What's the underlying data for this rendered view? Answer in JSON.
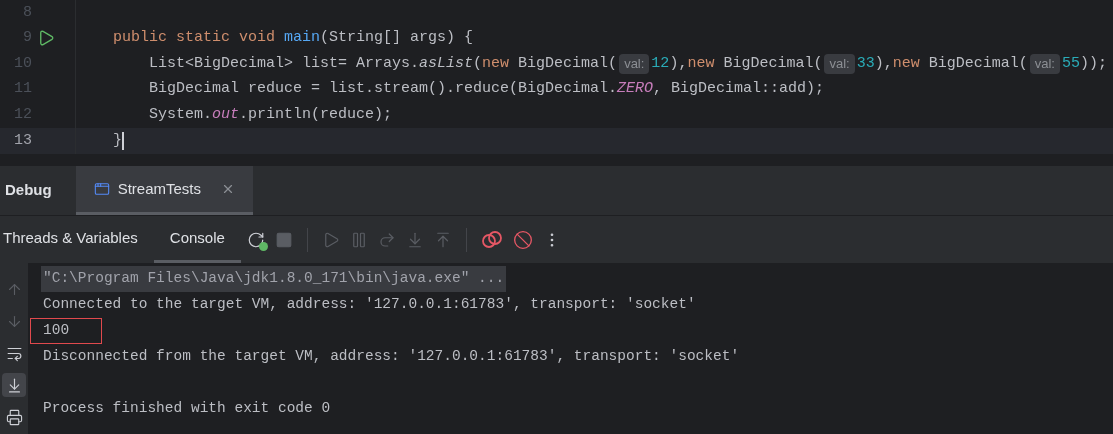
{
  "editor": {
    "lines": [
      {
        "number": "8",
        "current": false,
        "runnable": false,
        "kind": "blank"
      },
      {
        "number": "9",
        "current": false,
        "runnable": true,
        "kind": "signature",
        "tokens": [
          {
            "kind": "keyword",
            "text": "public static void "
          },
          {
            "kind": "method",
            "text": "main"
          },
          {
            "kind": "plain",
            "text": "(String[] args) {"
          }
        ]
      },
      {
        "number": "10",
        "current": false,
        "runnable": false,
        "kind": "statement",
        "tokens": [
          {
            "kind": "plain",
            "text": "List<BigDecimal> list= Arrays."
          },
          {
            "kind": "italic",
            "text": "asList"
          },
          {
            "kind": "plain",
            "text": "("
          },
          {
            "kind": "keyword",
            "text": "new "
          },
          {
            "kind": "plain",
            "text": "BigDecimal("
          },
          {
            "kind": "hint",
            "text": "val:"
          },
          {
            "kind": "number",
            "text": "12"
          },
          {
            "kind": "plain",
            "text": "),"
          },
          {
            "kind": "keyword",
            "text": "new "
          },
          {
            "kind": "plain",
            "text": "BigDecimal("
          },
          {
            "kind": "hint",
            "text": "val:"
          },
          {
            "kind": "number",
            "text": "33"
          },
          {
            "kind": "plain",
            "text": "),"
          },
          {
            "kind": "keyword",
            "text": "new "
          },
          {
            "kind": "plain",
            "text": "BigDecimal("
          },
          {
            "kind": "hint",
            "text": "val:"
          },
          {
            "kind": "number",
            "text": "55"
          },
          {
            "kind": "plain",
            "text": "));"
          }
        ]
      },
      {
        "number": "11",
        "current": false,
        "runnable": false,
        "kind": "statement",
        "tokens": [
          {
            "kind": "plain",
            "text": "BigDecimal reduce = list.stream().reduce(BigDecimal."
          },
          {
            "kind": "field",
            "text": "ZERO"
          },
          {
            "kind": "plain",
            "text": ", BigDecimal::add);"
          }
        ]
      },
      {
        "number": "12",
        "current": false,
        "runnable": false,
        "kind": "statement",
        "tokens": [
          {
            "kind": "plain",
            "text": "System."
          },
          {
            "kind": "field",
            "text": "out"
          },
          {
            "kind": "plain",
            "text": ".println(reduce);"
          }
        ]
      },
      {
        "number": "13",
        "current": true,
        "runnable": false,
        "kind": "signature",
        "tokens": [
          {
            "kind": "plain",
            "text": "}"
          }
        ]
      }
    ]
  },
  "debug": {
    "title": "Debug",
    "tabs": [
      {
        "label": "StreamTests",
        "selected": true
      }
    ],
    "sub_tabs": [
      {
        "label": "Threads & Variables",
        "selected": false
      },
      {
        "label": "Console",
        "selected": true
      }
    ],
    "toolbar": [
      {
        "kind": "rerun",
        "disabled": false
      },
      {
        "kind": "stop",
        "disabled": true
      },
      {
        "kind": "separator"
      },
      {
        "kind": "resume",
        "disabled": true
      },
      {
        "kind": "pause",
        "disabled": true
      },
      {
        "kind": "step-over",
        "disabled": true
      },
      {
        "kind": "step-into",
        "disabled": true
      },
      {
        "kind": "step-out",
        "disabled": true
      },
      {
        "kind": "separator"
      },
      {
        "kind": "breakpoints",
        "disabled": false
      },
      {
        "kind": "mute",
        "disabled": false
      },
      {
        "kind": "more",
        "disabled": false
      }
    ],
    "side_buttons": [
      {
        "kind": "up",
        "selected": false
      },
      {
        "kind": "down",
        "selected": false
      },
      {
        "kind": "wrap",
        "selected": false
      },
      {
        "kind": "scroll-end",
        "selected": true
      },
      {
        "kind": "print",
        "selected": false
      }
    ]
  },
  "console": {
    "lines": [
      {
        "kind": "command",
        "text": "\"C:\\Program Files\\Java\\jdk1.8.0_171\\bin\\java.exe\" ..."
      },
      {
        "kind": "output",
        "text": "Connected to the target VM, address: '127.0.0.1:61783', transport: 'socket'"
      },
      {
        "kind": "boxed",
        "text": "100"
      },
      {
        "kind": "output",
        "text": "Disconnected from the target VM, address: '127.0.0.1:61783', transport: 'socket'"
      },
      {
        "kind": "exit",
        "text": "Process finished with exit code 0"
      }
    ]
  }
}
